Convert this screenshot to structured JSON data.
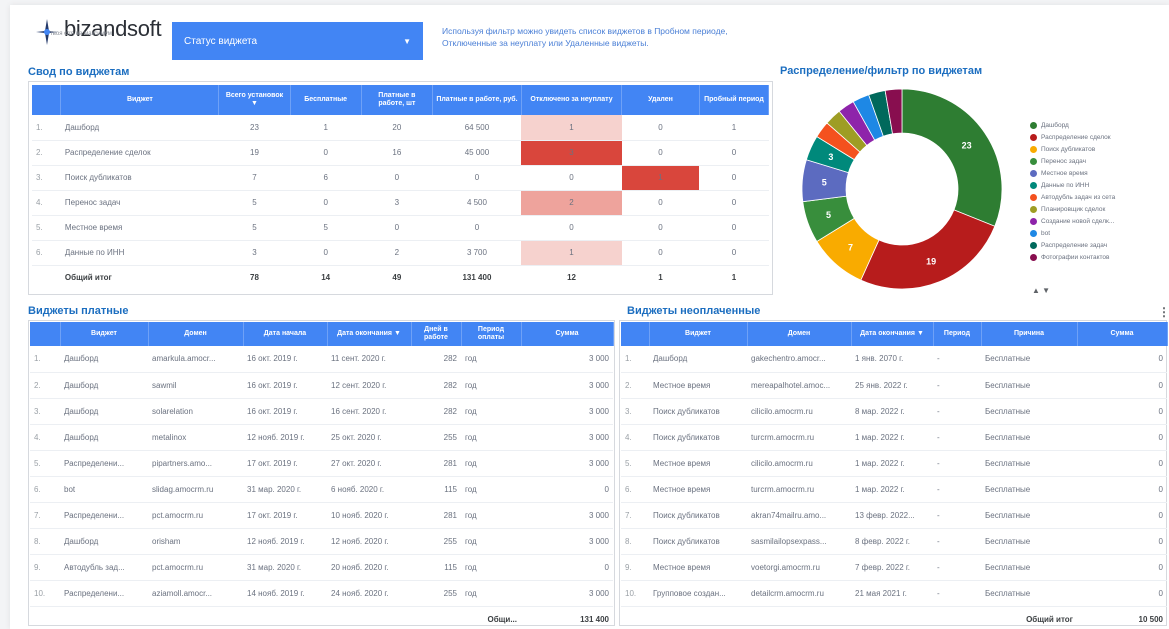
{
  "brand": {
    "name": "bizandsoft",
    "tagline": "твоя crm на максимум"
  },
  "filter": {
    "label": "Статус виджета"
  },
  "hint": "Используя фильтр можно увидеть список виджетов в Пробном периоде, Отключенные за неуплату или Удаленные виджеты.",
  "summary": {
    "title": "Свод по виджетам",
    "columns": [
      "",
      "Виджет",
      "Всего установок ▼",
      "Бесплатные",
      "Платные в работе, шт",
      "Платные в работе, руб.",
      "Отключено за неуплату",
      "Удален",
      "Пробный период"
    ],
    "rows": [
      [
        "1.",
        "Дашборд",
        "23",
        "1",
        "20",
        "64 500",
        "1",
        "0",
        "1"
      ],
      [
        "2.",
        "Распределение сделок",
        "19",
        "0",
        "16",
        "45 000",
        "3",
        "0",
        "0"
      ],
      [
        "3.",
        "Поиск дубликатов",
        "7",
        "6",
        "0",
        "0",
        "0",
        "1",
        "0"
      ],
      [
        "4.",
        "Перенос задач",
        "5",
        "0",
        "3",
        "4 500",
        "2",
        "0",
        "0"
      ],
      [
        "5.",
        "Местное время",
        "5",
        "5",
        "0",
        "0",
        "0",
        "0",
        "0"
      ],
      [
        "6.",
        "Данные по ИНН",
        "3",
        "0",
        "2",
        "3 700",
        "1",
        "0",
        "0"
      ]
    ],
    "total": [
      "",
      "Общий итог",
      "78",
      "14",
      "49",
      "131 400",
      "12",
      "1",
      "1"
    ]
  },
  "chart_data": {
    "type": "pie",
    "title": "Распределение/фильтр по виджетам",
    "donut": true,
    "categories": [
      "Дашборд",
      "Распределение сделок",
      "Поиск дубликатов",
      "Перенос задач",
      "Местное время",
      "Данные по ИНН",
      "Автодубль задач из сета",
      "Планировщик сделок",
      "Создание новой сделк...",
      "bot",
      "Распределение задач",
      "Фотографии контактов"
    ],
    "values": [
      23,
      19,
      7,
      5,
      5,
      3,
      2,
      2,
      2,
      2,
      2,
      2
    ],
    "data_labels": [
      "23",
      "19",
      "7",
      "5",
      "5",
      "3",
      "",
      "",
      "",
      "",
      "",
      ""
    ],
    "colors": [
      "#2e7d32",
      "#b71c1c",
      "#f9ab00",
      "#388e3c",
      "#5c6bc0",
      "#00897b",
      "#f4511e",
      "#9e9d24",
      "#8e24aa",
      "#1e88e5",
      "#00695c",
      "#880e4f"
    ],
    "legend_position": "right"
  },
  "paid": {
    "title": "Виджеты платные",
    "columns": [
      "",
      "Виджет",
      "Домен",
      "Дата начала",
      "Дата окончания ▼",
      "Дней в работе",
      "Период оплаты",
      "Сумма"
    ],
    "rows": [
      [
        "1.",
        "Дашборд",
        "amarkula.amocr...",
        "16 окт. 2019 г.",
        "11 сент. 2020 г.",
        "282",
        "год",
        "3 000"
      ],
      [
        "2.",
        "Дашборд",
        "sawmil",
        "16 окт. 2019 г.",
        "12 сент. 2020 г.",
        "282",
        "год",
        "3 000"
      ],
      [
        "3.",
        "Дашборд",
        "solarelation",
        "16 окт. 2019 г.",
        "16 сент. 2020 г.",
        "282",
        "год",
        "3 000"
      ],
      [
        "4.",
        "Дашборд",
        "metalinox",
        "12 нояб. 2019 г.",
        "25 окт. 2020 г.",
        "255",
        "год",
        "3 000"
      ],
      [
        "5.",
        "Распределени...",
        "pipartners.amo...",
        "17 окт. 2019 г.",
        "27 окт. 2020 г.",
        "281",
        "год",
        "3 000"
      ],
      [
        "6.",
        "bot",
        "slidag.amocrm.ru",
        "31 мар. 2020 г.",
        "6 нояб. 2020 г.",
        "115",
        "год",
        "0"
      ],
      [
        "7.",
        "Распределени...",
        "pct.amocrm.ru",
        "17 окт. 2019 г.",
        "10 нояб. 2020 г.",
        "281",
        "год",
        "3 000"
      ],
      [
        "8.",
        "Дашборд",
        "orisham",
        "12 нояб. 2019 г.",
        "12 нояб. 2020 г.",
        "255",
        "год",
        "3 000"
      ],
      [
        "9.",
        "Автодубль зад...",
        "pct.amocrm.ru",
        "31 мар. 2020 г.",
        "20 нояб. 2020 г.",
        "115",
        "год",
        "0"
      ],
      [
        "10.",
        "Распределени...",
        "aziamoll.amocr...",
        "14 нояб. 2019 г.",
        "24 нояб. 2020 г.",
        "255",
        "год",
        "3 000"
      ]
    ],
    "total_label": "Общи...",
    "total_value": "131 400"
  },
  "unpaid": {
    "title": "Виджеты неоплаченные",
    "columns": [
      "",
      "Виджет",
      "Домен",
      "Дата окончания ▼",
      "Период",
      "Причина",
      "Сумма"
    ],
    "rows": [
      [
        "1.",
        "Дашборд",
        "gakechentro.amocr...",
        "1 янв. 2070 г.",
        "-",
        "Бесплатные",
        "0"
      ],
      [
        "2.",
        "Местное время",
        "mereapalhotel.amoc...",
        "25 янв. 2022 г.",
        "-",
        "Бесплатные",
        "0"
      ],
      [
        "3.",
        "Поиск дубликатов",
        "cilicilo.amocrm.ru",
        "8 мар. 2022 г.",
        "-",
        "Бесплатные",
        "0"
      ],
      [
        "4.",
        "Поиск дубликатов",
        "turcrm.amocrm.ru",
        "1 мар. 2022 г.",
        "-",
        "Бесплатные",
        "0"
      ],
      [
        "5.",
        "Местное время",
        "cilicilo.amocrm.ru",
        "1 мар. 2022 г.",
        "-",
        "Бесплатные",
        "0"
      ],
      [
        "6.",
        "Местное время",
        "turcrm.amocrm.ru",
        "1 мар. 2022 г.",
        "-",
        "Бесплатные",
        "0"
      ],
      [
        "7.",
        "Поиск дубликатов",
        "akran74mailru.amo...",
        "13 февр. 2022...",
        "-",
        "Бесплатные",
        "0"
      ],
      [
        "8.",
        "Поиск дубликатов",
        "sasmilailopsexpass...",
        "8 февр. 2022 г.",
        "-",
        "Бесплатные",
        "0"
      ],
      [
        "9.",
        "Местное время",
        "voetorgi.amocrm.ru",
        "7 февр. 2022 г.",
        "-",
        "Бесплатные",
        "0"
      ],
      [
        "10.",
        "Групповое создан...",
        "detailcrm.amocrm.ru",
        "21 мая 2021 г.",
        "-",
        "Бесплатные",
        "0"
      ]
    ],
    "total_label": "Общий итог",
    "total_value": "10 500"
  },
  "heat": {
    "strong": "#d9463c",
    "medium": "#eea39c",
    "light": "#f6d2ce"
  }
}
